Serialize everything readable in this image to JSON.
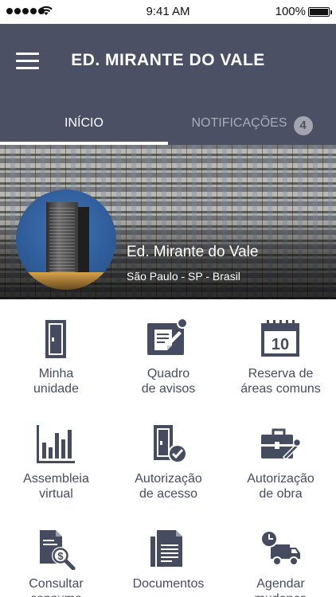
{
  "status_bar": {
    "time": "9:41 AM",
    "battery": "100%",
    "icons": [
      "signal-icon",
      "wifi-icon",
      "battery-icon"
    ]
  },
  "header": {
    "title": "ED. MIRANTE DO VALE",
    "menu_icon": "hamburger-menu-icon"
  },
  "tabs": {
    "home": "INÍCIO",
    "notifications": "NOTIFICAÇÕES",
    "notifications_count": "4"
  },
  "building": {
    "name": "Ed. Mirante do Vale",
    "location": "São Paulo - SP - Brasil"
  },
  "menu": [
    {
      "label": "Minha\nunidade",
      "icon": "door-icon"
    },
    {
      "label": "Quadro\nde avisos",
      "icon": "notice-board-icon"
    },
    {
      "label": "Reserva de\náreas comuns",
      "icon": "calendar-icon",
      "icon_text": "10"
    },
    {
      "label": "Assembleia\nvirtual",
      "icon": "bar-chart-icon"
    },
    {
      "label": "Autorização\nde acesso",
      "icon": "access-door-check-icon"
    },
    {
      "label": "Autorização\nde obra",
      "icon": "toolbox-icon"
    },
    {
      "label": "Consultar\nconsumo",
      "icon": "document-search-icon"
    },
    {
      "label": "Documentos",
      "icon": "documents-icon"
    },
    {
      "label": "Agendar\nmudança",
      "icon": "moving-truck-icon"
    }
  ],
  "colors": {
    "header_bg": "#4b5064",
    "icon": "#464c60",
    "badge": "#a2a5b0"
  }
}
